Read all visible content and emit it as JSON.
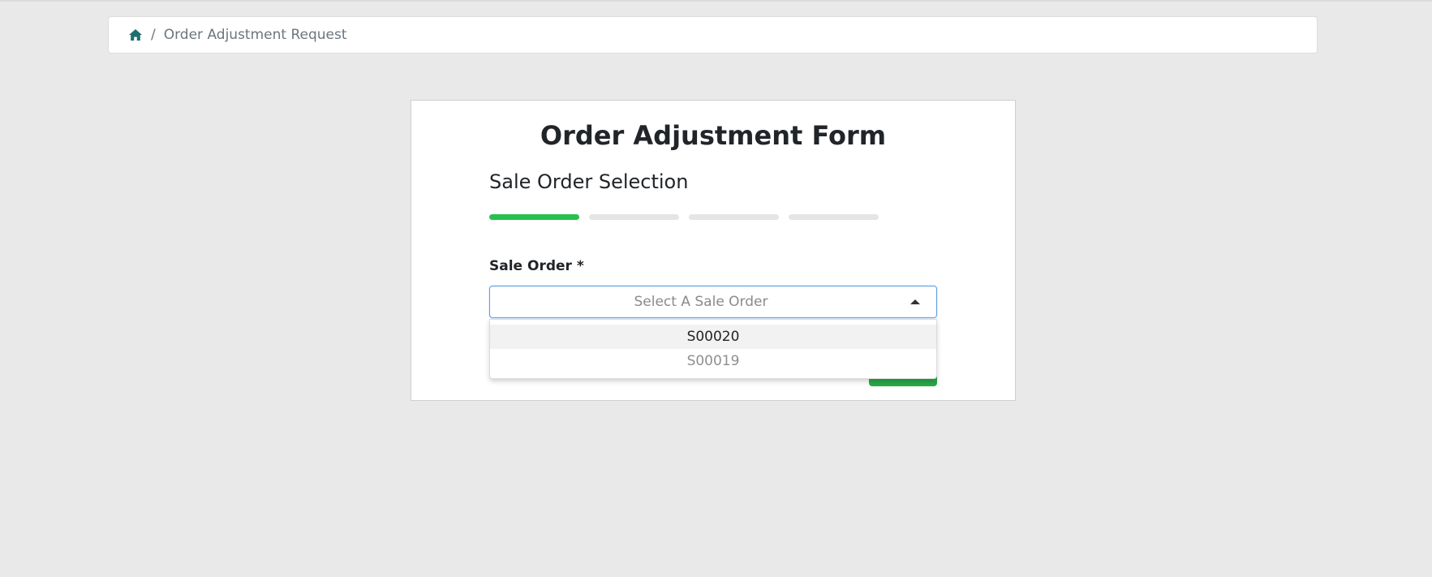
{
  "breadcrumb": {
    "home_icon": "home-icon",
    "separator": "/",
    "current": "Order Adjustment Request"
  },
  "form": {
    "title": "Order Adjustment Form",
    "step_title": "Sale Order Selection",
    "steps": {
      "total": 4,
      "active": 1,
      "active_color": "#28c04f",
      "inactive_color": "#e5e5e5"
    },
    "sale_order": {
      "label": "Sale Order *",
      "placeholder": "Select A Sale Order",
      "value": "",
      "options": [
        {
          "label": "S00020",
          "highlighted": true
        },
        {
          "label": "S00019",
          "highlighted": false
        }
      ]
    }
  },
  "colors": {
    "page_bg": "#e9e9e9",
    "home_icon": "#1f6f6f",
    "focus_border": "#5aa0e6",
    "button_green": "#28a745"
  }
}
